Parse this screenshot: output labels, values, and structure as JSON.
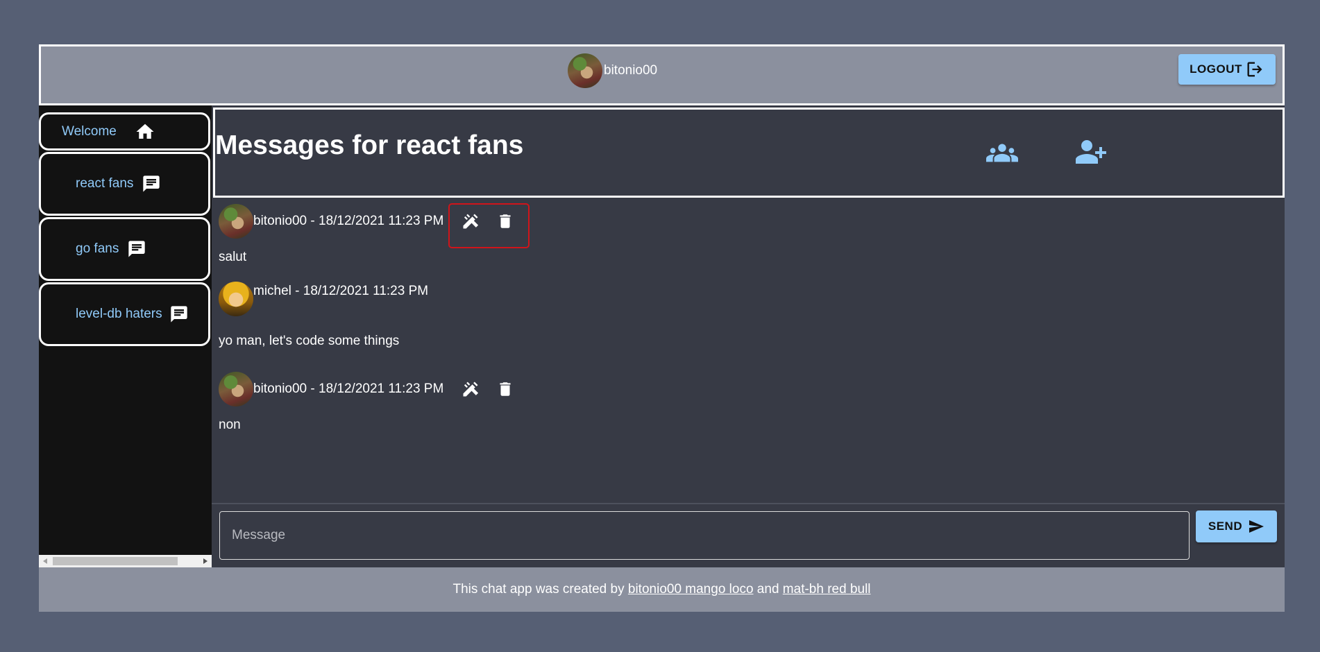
{
  "header": {
    "username": "bitonio00",
    "logout_label": "LOGOUT"
  },
  "sidebar": {
    "items": [
      {
        "label": "Welcome",
        "icon": "home-icon"
      },
      {
        "label": "react fans",
        "icon": "chat-icon"
      },
      {
        "label": "go fans",
        "icon": "chat-icon"
      },
      {
        "label": "level-db haters",
        "icon": "chat-icon"
      }
    ]
  },
  "main": {
    "title": "Messages for react fans",
    "messages": [
      {
        "meta": "bitonio00 - 18/12/2021 11:23 PM",
        "body": "salut"
      },
      {
        "meta": "michel - 18/12/2021 11:23 PM",
        "body": "yo man, let's code some things"
      },
      {
        "meta": "bitonio00 - 18/12/2021 11:23 PM",
        "body": "non"
      }
    ],
    "input_placeholder": "Message",
    "send_label": "SEND"
  },
  "footer": {
    "prefix": "This chat app was created by ",
    "link1": "bitonio00 mango loco",
    "middle": " and ",
    "link2": "mat-bh red bull"
  },
  "colors": {
    "accent": "#90caf9",
    "highlight": "#d0141a"
  }
}
